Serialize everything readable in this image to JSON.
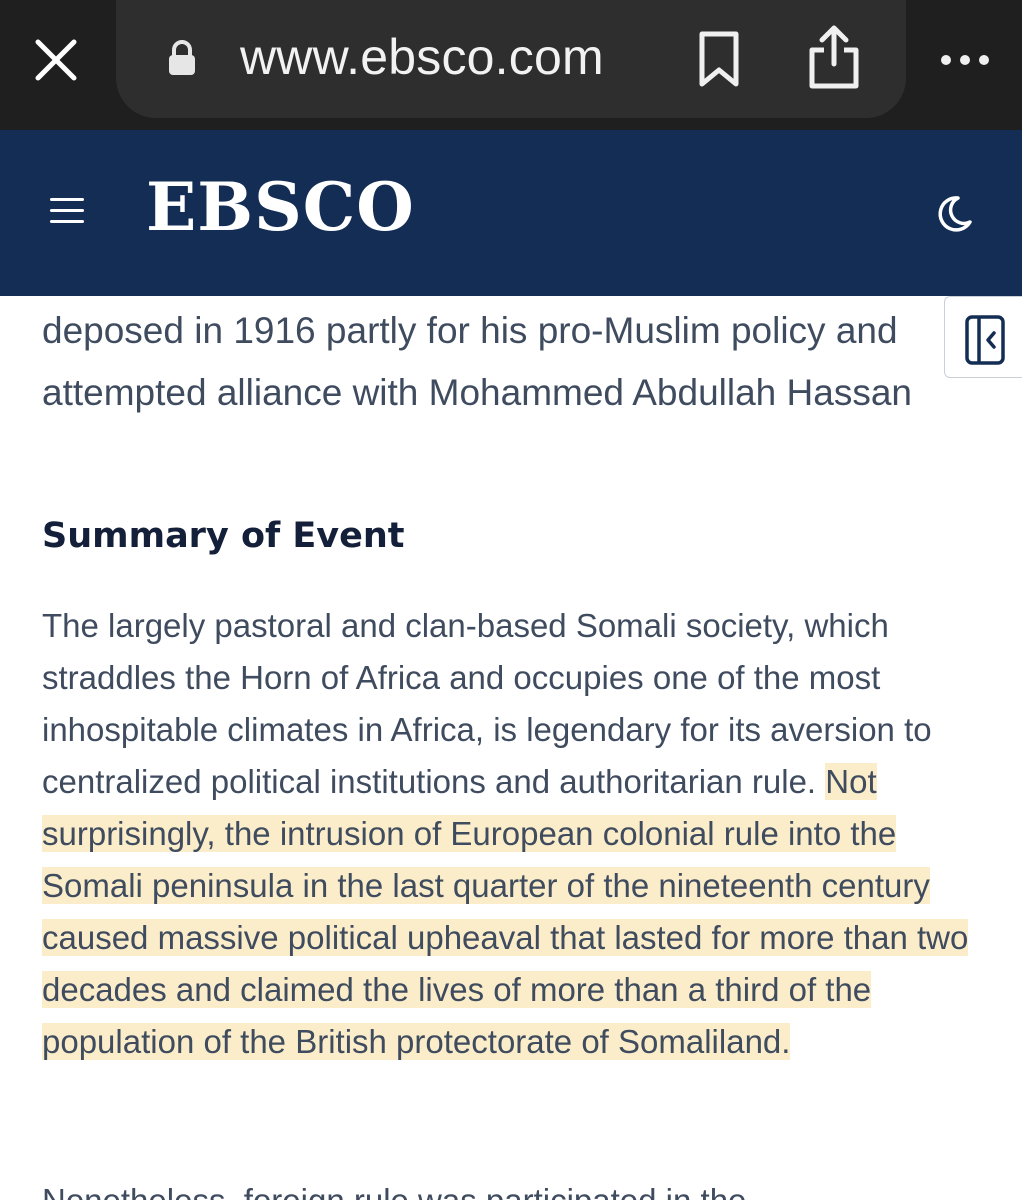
{
  "browser": {
    "url": "www.ebsco.com"
  },
  "header": {
    "logo": "EBSCO"
  },
  "article": {
    "lead": "deposed in 1916 partly for his pro-Muslim policy and attempted alliance with Mohammed Abdullah Hassan",
    "section_heading": "Summary of Event",
    "paragraph_plain": "The largely pastoral and clan-based Somali society, which straddles the Horn of Africa and occupies one of the most inhospitable climates in Africa, is legendary for its aversion to centralized political institutions and authoritarian rule. ",
    "paragraph_highlighted": "Not surprisingly, the intrusion of European colonial rule into the Somali peninsula in the last quarter of the nineteenth century caused massive political upheaval that lasted for more than two decades and claimed the lives of more than a third of the population of the British protectorate of Somaliland.",
    "next_line_partial": "Nonetheless, foreign rule was participated in the"
  },
  "colors": {
    "chrome_bg": "#1f1f1f",
    "header_bg": "#132d55",
    "highlight": "#fbedc9"
  }
}
